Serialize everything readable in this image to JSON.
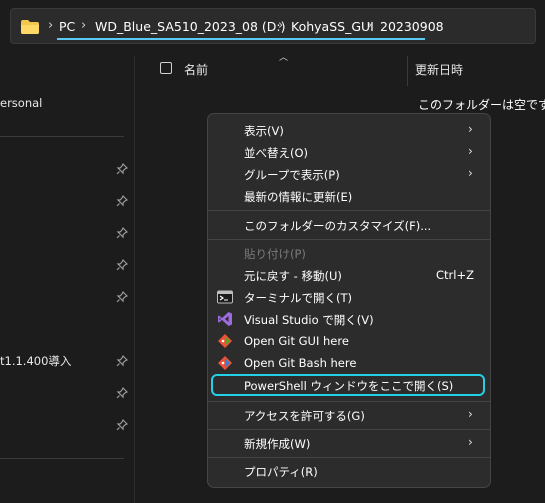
{
  "address_bar": {
    "breadcrumbs": [
      "PC",
      "WD_Blue_SA510_2023_08 (D:)",
      "KohyaSS_GUI",
      "20230908"
    ]
  },
  "nav_pane": {
    "items": [
      "ersonal",
      "t1.1.400導入"
    ]
  },
  "columns": {
    "name": "名前",
    "date_modified": "更新日時"
  },
  "empty_message": "このフォルダーは空です。",
  "context_menu": {
    "items": [
      {
        "label": "表示(V)",
        "submenu": true
      },
      {
        "label": "並べ替え(O)",
        "submenu": true
      },
      {
        "label": "グループで表示(P)",
        "submenu": true
      },
      {
        "label": "最新の情報に更新(E)",
        "submenu": false
      },
      {
        "label": "このフォルダーのカスタマイズ(F)...",
        "submenu": false
      },
      {
        "label": "貼り付け(P)",
        "disabled": true
      },
      {
        "label": "元に戻す - 移動(U)",
        "shortcut": "Ctrl+Z"
      },
      {
        "label": "ターミナルで開く(T)",
        "icon": "terminal-icon"
      },
      {
        "label": "Visual Studio で開く(V)",
        "icon": "visual-studio-icon"
      },
      {
        "label": "Open Git GUI here",
        "icon": "git-gui-icon"
      },
      {
        "label": "Open Git Bash here",
        "icon": "git-bash-icon"
      },
      {
        "label": "PowerShell ウィンドウをここで開く(S)",
        "highlighted": true
      },
      {
        "label": "アクセスを許可する(G)",
        "submenu": true
      },
      {
        "label": "新規作成(W)",
        "submenu": true
      },
      {
        "label": "プロパティ(R)",
        "submenu": false
      }
    ]
  },
  "colors": {
    "background": "#1c1c1c",
    "menu_background": "#2c2c2c",
    "highlight_border": "#23d0e6",
    "breadcrumb_underline": "#5bc8f5"
  }
}
